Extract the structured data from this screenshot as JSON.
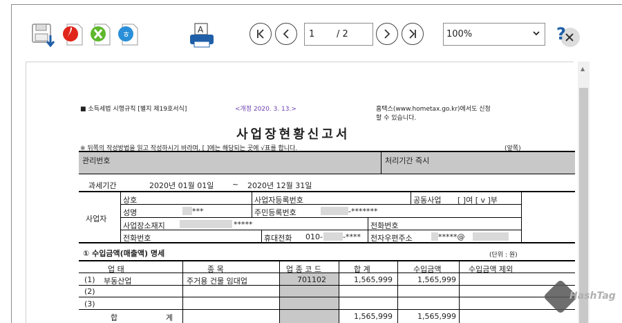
{
  "toolbar": {
    "save_icon": "save-download-icon",
    "pdf_icon": "pdf-icon",
    "excel_icon": "excel-icon",
    "hwp_icon": "hangul-doc-icon",
    "print_icon": "printer-icon",
    "first_page_icon": "first-page-icon",
    "prev_page_icon": "prev-page-icon",
    "next_page_icon": "next-page-icon",
    "last_page_icon": "last-page-icon",
    "current_page": "1",
    "total_pages": "/ 2",
    "zoom_value": "100%",
    "help_icon": "help-close-icon"
  },
  "doc": {
    "header_left": "■ 소득세법 시행규칙 [별지 제19호서식]",
    "header_amend": "<개정 2020. 3. 13.>",
    "header_right_1": "홈택스(www.hometax.go.kr)에서도 신청",
    "header_right_2": "할 수 있습니다.",
    "title": "사업장현황신고서",
    "notice": "※ 뒤쪽의 작성방법을 읽고 작성하시기 바라며, [  ]에는 해당되는 곳에 √표를 합니다.",
    "front": "(앞쪽)",
    "mgmt_no": "관리번호",
    "proc_period": "처리기간 즉시",
    "tax_period_label": "과세기간",
    "tax_period_from": "2020년  01월  01일",
    "tax_period_tilde": "~",
    "tax_period_to": "2020년  12월  31일",
    "business_label": "사업자",
    "f_name": "상호",
    "f_biz_reg": "사업자등록번호",
    "f_joint": "공동사업",
    "f_joint_val": "[     ]여   [ v ]부",
    "f_person": "성명",
    "f_person_val": "***",
    "f_rrn": "주민등록번호",
    "f_rrn_val": "-*******",
    "f_addr": "사업장소재지",
    "f_addr_val": "*****",
    "f_phone": "전화번호",
    "f_tel": "전화번호",
    "f_mobile": "휴대전화",
    "f_mobile_val": "010-",
    "f_mobile_tail": "-****",
    "f_email": "전자우편주소",
    "f_email_val": "*****@",
    "section1": "① 수입금액(매출액) 명세",
    "unit": "(단위 : 원)",
    "col_type": "업         태",
    "col_item": "종         목",
    "col_code": "업 종 코 드",
    "col_total": "합         계",
    "col_income": "수입금액",
    "col_excl": "수입금액 제외",
    "rows": [
      {
        "no": "(1)",
        "type": "부동산업",
        "item": "주거용 건물 임대업",
        "code": "701102",
        "total": "1,565,999",
        "income": "1,565,999"
      },
      {
        "no": "(2)",
        "type": "",
        "item": "",
        "code": "",
        "total": "",
        "income": ""
      },
      {
        "no": "(3)",
        "type": "",
        "item": "",
        "code": "",
        "total": "",
        "income": ""
      }
    ],
    "sum_label_a": "합",
    "sum_label_b": "계",
    "sum_total": "1,565,999",
    "sum_income": "1,565,999"
  },
  "watermark": "HashTag"
}
